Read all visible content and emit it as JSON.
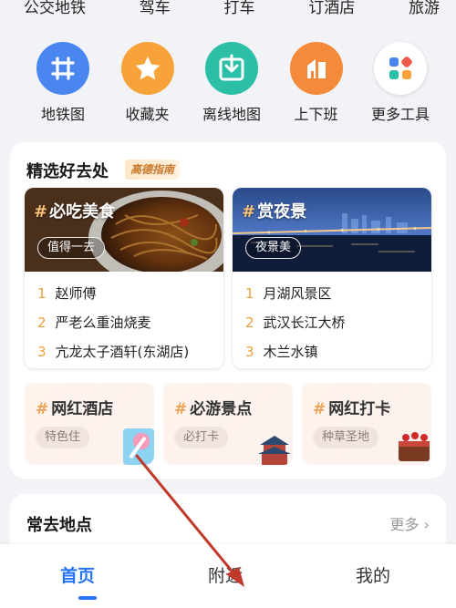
{
  "top_row": [
    "公交地铁",
    "驾车",
    "打车",
    "订酒店",
    "旅游"
  ],
  "quick_icons": [
    {
      "label": "地铁图",
      "icon": "subway-map-icon",
      "color": "#4a86f0"
    },
    {
      "label": "收藏夹",
      "icon": "star-icon",
      "color": "#f7a33a"
    },
    {
      "label": "离线地图",
      "icon": "download-icon",
      "color": "#2bbfa7"
    },
    {
      "label": "上下班",
      "icon": "home-work-icon",
      "color": "#f48a3a"
    },
    {
      "label": "更多工具",
      "icon": "grid-apps-icon",
      "color": "#ffffff"
    }
  ],
  "picks": {
    "title": "精选好去处",
    "badge": "高德指南",
    "featured": [
      {
        "title": "必吃美食",
        "pill": "值得一去",
        "items": [
          {
            "n": "1",
            "text": "赵师傅"
          },
          {
            "n": "2",
            "text": "严老么重油烧麦"
          },
          {
            "n": "3",
            "text": "亢龙太子酒轩(东湖店)"
          }
        ]
      },
      {
        "title": "赏夜景",
        "pill": "夜景美",
        "items": [
          {
            "n": "1",
            "text": "月湖风景区"
          },
          {
            "n": "2",
            "text": "武汉长江大桥"
          },
          {
            "n": "3",
            "text": "木兰水镇"
          }
        ]
      }
    ],
    "small": [
      {
        "title": "网红酒店",
        "pill": "特色住"
      },
      {
        "title": "必游景点",
        "pill": "必打卡"
      },
      {
        "title": "网红打卡",
        "pill": "种草圣地"
      }
    ],
    "hash": "#"
  },
  "frequent": {
    "title": "常去地点",
    "more": "更多 ›"
  },
  "tabs": {
    "home": "首页",
    "nearby": "附近",
    "mine": "我的"
  },
  "colors": {
    "accent": "#2573f5",
    "annotation_arrow": "#c0392b"
  }
}
